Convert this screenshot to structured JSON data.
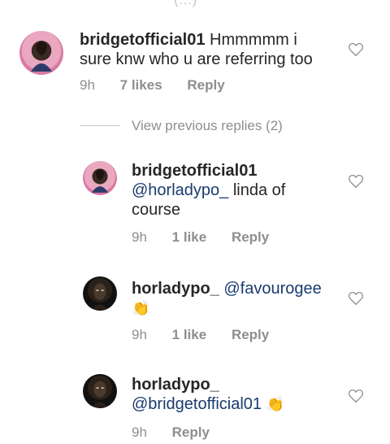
{
  "top_fragment": "(…)",
  "comments": [
    {
      "user": "bridgetofficial01",
      "mention": "",
      "text_line1": "Hmmmmm i",
      "text_line2": "sure knw who u are referring too",
      "time": "9h",
      "likes": "7 likes",
      "reply": "Reply"
    }
  ],
  "view_previous": "View previous replies (2)",
  "replies": [
    {
      "user": "bridgetofficial01",
      "mention": "@horladypo_",
      "text_after_mention": " linda of",
      "text_line2": "course",
      "time": "9h",
      "likes": "1 like",
      "reply": "Reply"
    },
    {
      "user": "horladypo_",
      "mention": "@favourogee",
      "emoji": "👏",
      "time": "9h",
      "likes": "1 like",
      "reply": "Reply"
    },
    {
      "user": "horladypo_",
      "mention": "@bridgetofficial01",
      "emoji": "👏",
      "time": "9h",
      "reply": "Reply"
    }
  ],
  "colors": {
    "text": "#262626",
    "secondary": "#8e8e8e",
    "mention": "#1a3b6e",
    "heart": "#8e8e8e"
  }
}
